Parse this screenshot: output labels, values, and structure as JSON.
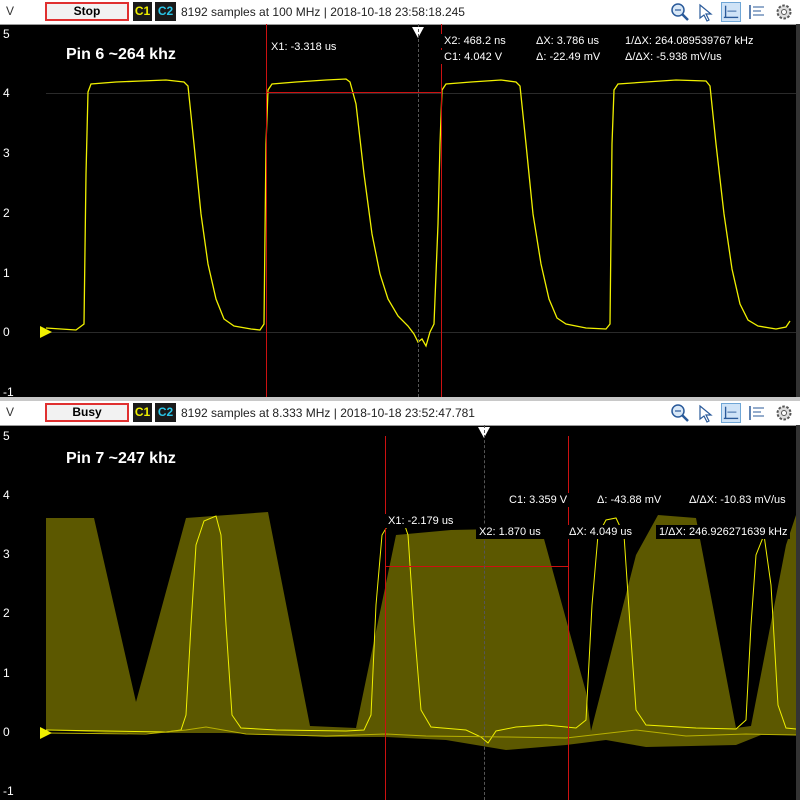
{
  "colors": {
    "ch1": "#f0f000",
    "ch2": "#29c6e8",
    "cursor": "#cc1111",
    "stop_border": "#e03030"
  },
  "panels": [
    {
      "axis_letter": "V",
      "status": "Stop",
      "ch1": "C1",
      "ch2": "C2",
      "info": "8192 samples at 100 MHz | 2018-10-18 23:58:18.245",
      "icons": [
        "zoom-icon",
        "cursor-icon",
        "horizontal-cursor-icon",
        "vertical-cursor-icon",
        "settings-icon"
      ],
      "ytick_labels": [
        "5",
        "4",
        "3",
        "2",
        "1",
        "0",
        "-1"
      ],
      "trace_label": "Pin 6 ~264 khz",
      "measurements": {
        "x1": "X1: -3.318 us",
        "x2": "X2: 468.2 ns",
        "dx": "ΔX: 3.786 us",
        "inv_dx": "1/ΔX: 264.089539767 kHz",
        "c1": "C1: 4.042 V",
        "delta": "Δ: -22.49 mV",
        "delta_per_dx": "Δ/ΔX: -5.938 mV/us"
      }
    },
    {
      "axis_letter": "V",
      "status": "Busy",
      "ch1": "C1",
      "ch2": "C2",
      "info": "8192 samples at 8.333 MHz | 2018-10-18 23:52:47.781",
      "icons": [
        "zoom-icon",
        "cursor-icon",
        "horizontal-cursor-icon",
        "vertical-cursor-icon",
        "settings-icon"
      ],
      "ytick_labels": [
        "5",
        "4",
        "3",
        "2",
        "1",
        "0",
        "-1"
      ],
      "trace_label": "Pin 7 ~247 khz",
      "measurements": {
        "c1": "C1: 3.359 V",
        "delta": "Δ: -43.88 mV",
        "delta_per_dx": "Δ/ΔX: -10.83 mV/us",
        "x1": "X1: -2.179 us",
        "x2": "X2: 1.870 us",
        "dx": "ΔX: 4.049 us",
        "inv_dx": "1/ΔX: 246.926271639 kHz"
      }
    }
  ]
}
